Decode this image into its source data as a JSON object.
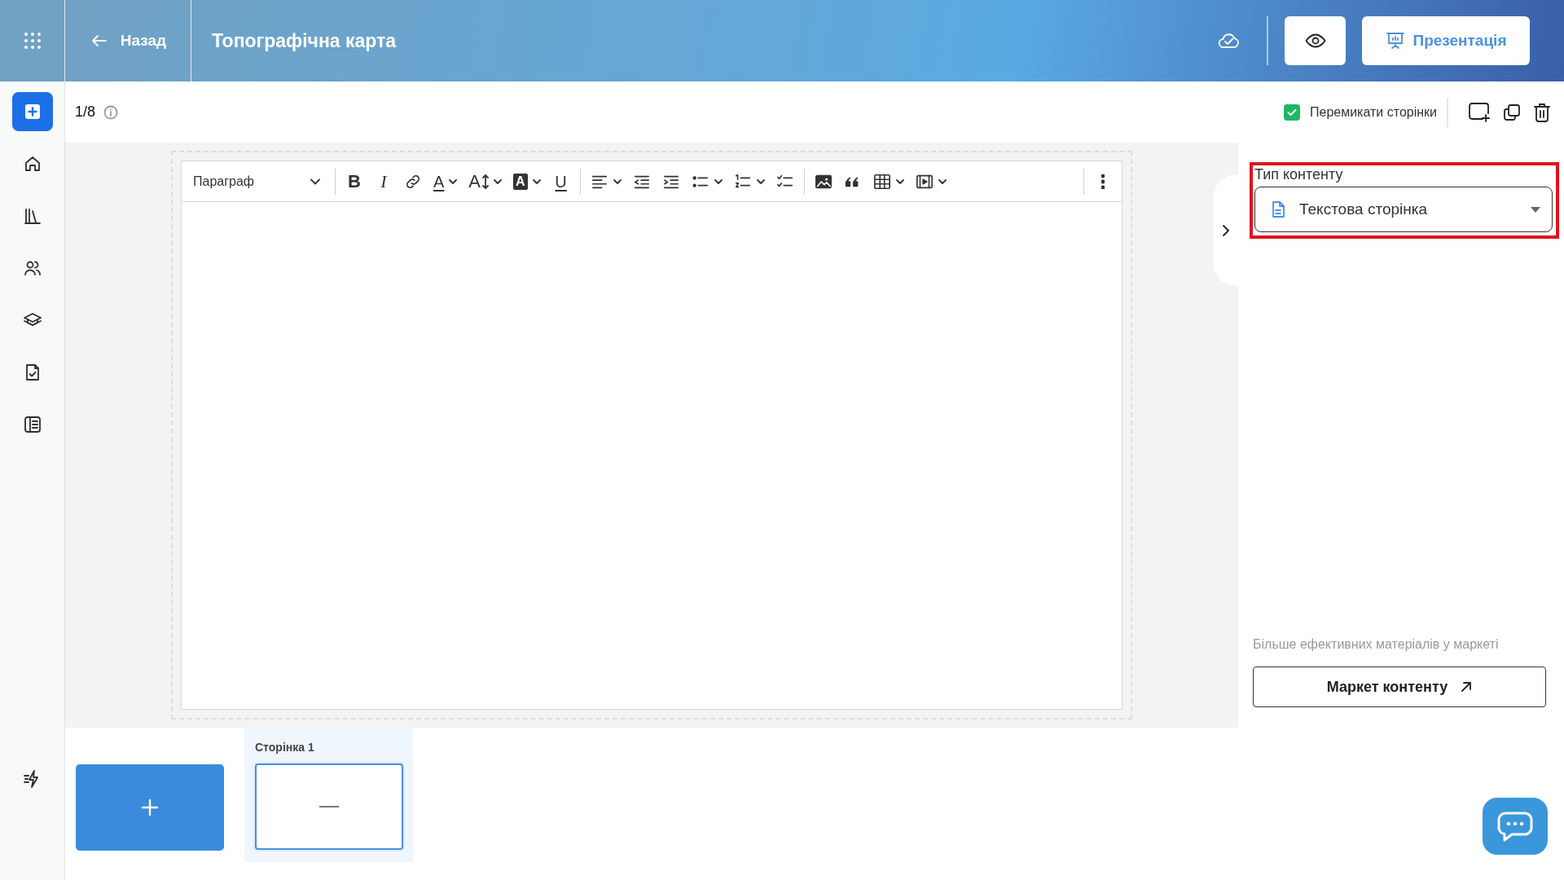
{
  "header": {
    "back": "Назад",
    "title": "Топографічна карта",
    "present_button": "Презентація"
  },
  "sidebar": {
    "items": [
      {
        "kind": "add",
        "selected": true
      },
      {
        "kind": "home",
        "selected": false
      },
      {
        "kind": "library",
        "selected": false
      },
      {
        "kind": "users",
        "selected": false
      },
      {
        "kind": "courses",
        "selected": false
      },
      {
        "kind": "tasks",
        "selected": false
      },
      {
        "kind": "journal",
        "selected": false
      },
      {
        "kind": "bolt",
        "selected": false
      }
    ]
  },
  "page_counter": "1/8",
  "switch_pages": {
    "label": "Перемикати сторінки",
    "checked": true
  },
  "editor": {
    "toolbar": [
      {
        "kind": "select",
        "text": "Параграф"
      },
      {
        "kind": "separator"
      },
      {
        "kind": "bold",
        "text": "B"
      },
      {
        "kind": "italic",
        "text": "I"
      },
      {
        "kind": "link"
      },
      {
        "kind": "font-color",
        "text": "A",
        "dropdown": true
      },
      {
        "kind": "font-size",
        "text": "A",
        "dropdown": true
      },
      {
        "kind": "highlight",
        "text": "A",
        "dropdown": true
      },
      {
        "kind": "underline",
        "text": "U"
      },
      {
        "kind": "separator"
      },
      {
        "kind": "align",
        "dropdown": true
      },
      {
        "kind": "outdent"
      },
      {
        "kind": "indent"
      },
      {
        "kind": "bullets",
        "dropdown": true
      },
      {
        "kind": "numbers",
        "dropdown": true
      },
      {
        "kind": "checklist"
      },
      {
        "kind": "separator"
      },
      {
        "kind": "image"
      },
      {
        "kind": "quote"
      },
      {
        "kind": "table",
        "dropdown": true
      },
      {
        "kind": "media",
        "dropdown": true
      },
      {
        "kind": "spacer"
      },
      {
        "kind": "separator"
      },
      {
        "kind": "more"
      }
    ]
  },
  "content_type": {
    "label": "Тип контенту",
    "value": "Текстова сторінка"
  },
  "market": {
    "hint": "Більше ефективних матеріалів у маркеті",
    "button": "Маркет контенту"
  },
  "pages": [
    {
      "label": "Сторінка 1",
      "selected": true
    }
  ]
}
